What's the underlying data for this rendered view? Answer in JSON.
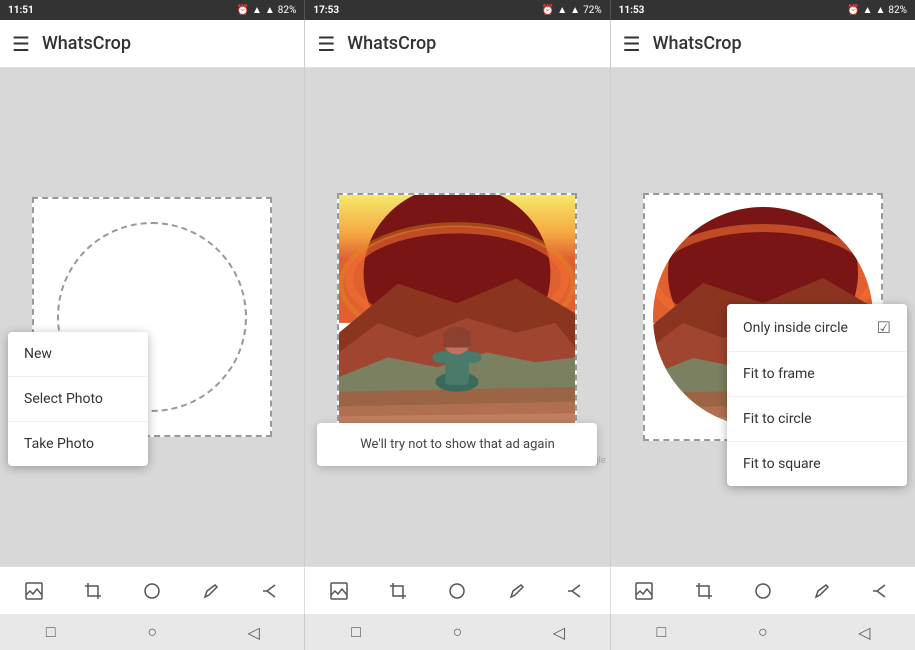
{
  "panels": [
    {
      "id": "panel1",
      "statusBar": {
        "time": "11:51",
        "rightIcons": "⏰ 📶 82%"
      },
      "appTitle": "WhatsCrop",
      "menuIcon": "☰"
    },
    {
      "id": "panel2",
      "statusBar": {
        "time": "17:53",
        "rightIcons": "⏰ 📶 72%"
      },
      "appTitle": "WhatsCrop",
      "menuIcon": "☰"
    },
    {
      "id": "panel3",
      "statusBar": {
        "time": "11:53",
        "rightIcons": "⏰ 📶 82%"
      },
      "appTitle": "WhatsCrop",
      "menuIcon": "☰"
    }
  ],
  "contextMenu": {
    "items": [
      {
        "label": "New",
        "id": "new"
      },
      {
        "label": "Select Photo",
        "id": "select-photo"
      },
      {
        "label": "Take Photo",
        "id": "take-photo"
      }
    ]
  },
  "adNotice": {
    "text": "We'll try not to show that ad again"
  },
  "poweredBy": {
    "text": "powered by Google"
  },
  "optionsMenu": {
    "items": [
      {
        "label": "Only inside circle",
        "id": "only-inside-circle",
        "checked": true
      },
      {
        "label": "Fit to frame",
        "id": "fit-to-frame",
        "checked": false
      },
      {
        "label": "Fit to circle",
        "id": "fit-to-circle",
        "checked": false
      },
      {
        "label": "Fit to square",
        "id": "fit-to-square",
        "checked": false
      }
    ]
  },
  "bottomToolbar": {
    "icons": [
      "🖼",
      "✂",
      "⭕",
      "✏",
      "↗"
    ]
  },
  "bottomNav": {
    "icons": [
      "□",
      "○",
      "◁"
    ]
  }
}
